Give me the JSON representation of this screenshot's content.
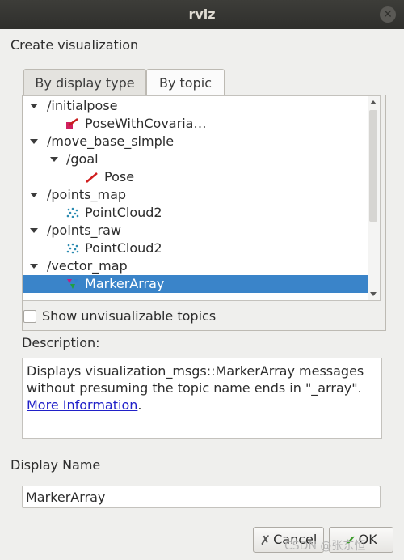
{
  "window": {
    "title": "rviz",
    "close_glyph": "✕"
  },
  "section_title": "Create visualization",
  "tabs": [
    {
      "label": "By display type",
      "active": false
    },
    {
      "label": "By topic",
      "active": true
    }
  ],
  "tree": [
    {
      "label": "/initialpose",
      "type": "topic",
      "expanded": true
    },
    {
      "label": "PoseWithCovaria…",
      "type": "display",
      "icon": "pose-with-covariance-icon"
    },
    {
      "label": "/move_base_simple",
      "type": "topic",
      "expanded": true
    },
    {
      "label": "/goal",
      "type": "topic",
      "expanded": true
    },
    {
      "label": "Pose",
      "type": "display",
      "icon": "pose-arrow-icon"
    },
    {
      "label": "/points_map",
      "type": "topic",
      "expanded": true
    },
    {
      "label": "PointCloud2",
      "type": "display",
      "icon": "pointcloud-icon"
    },
    {
      "label": "/points_raw",
      "type": "topic",
      "expanded": true
    },
    {
      "label": "PointCloud2",
      "type": "display",
      "icon": "pointcloud-icon"
    },
    {
      "label": "/vector_map",
      "type": "topic",
      "expanded": true
    },
    {
      "label": "MarkerArray",
      "type": "display",
      "icon": "marker-array-icon",
      "selected": true
    }
  ],
  "show_unvisualizable": {
    "label": "Show unvisualizable topics",
    "checked": false
  },
  "description": {
    "label": "Description:",
    "text_1": "Displays visualization_msgs::MarkerArray messages without presuming the topic name ends in \"_array\".",
    "link": "More Information",
    "suffix": "."
  },
  "display_name": {
    "label": "Display Name",
    "value": "MarkerArray"
  },
  "buttons": {
    "cancel": "Cancel",
    "ok": "OK"
  },
  "watermark": "CSDN @张东恒",
  "colors": {
    "selection": "#3a84c9",
    "link": "#2020c8",
    "titlebar": "#3d3d39"
  }
}
